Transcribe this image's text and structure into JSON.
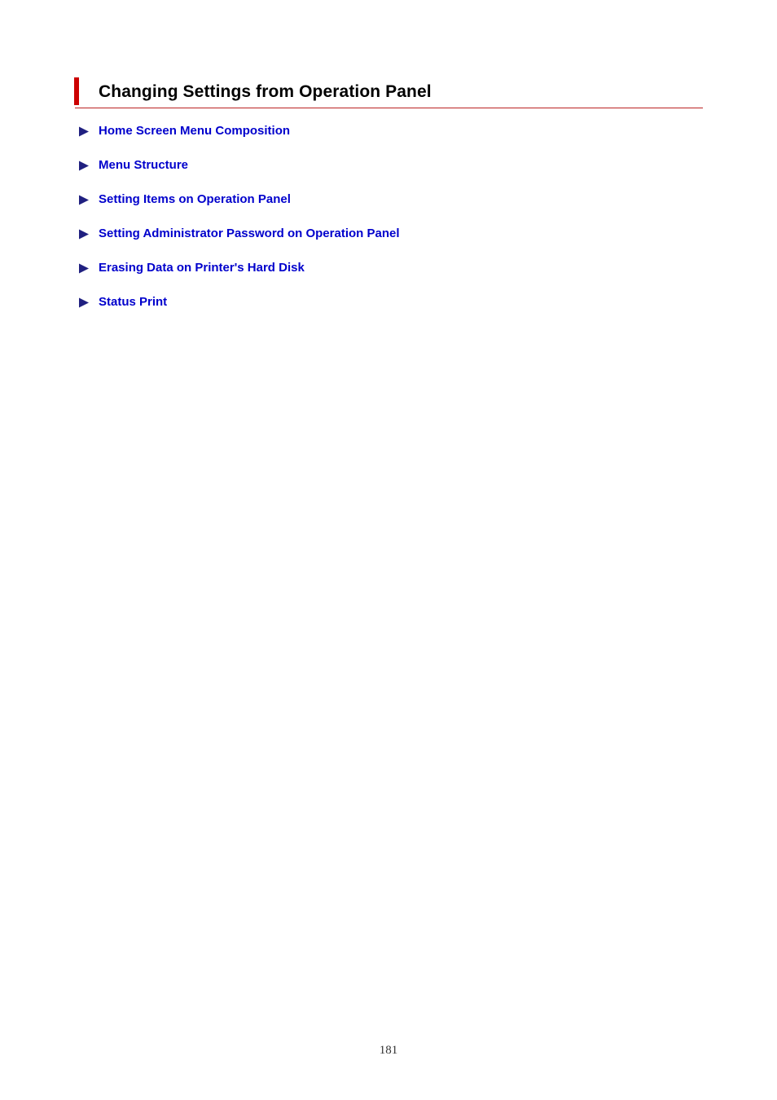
{
  "document": {
    "title": "Changing Settings from Operation Panel",
    "accent_color": "#CC0000",
    "rule_color": "#BB2222",
    "link_color": "#0000CC",
    "arrow_color": "#202080",
    "page_number": "181"
  },
  "links": [
    {
      "label": "Home Screen Menu Composition",
      "icon": "arrow-right-icon"
    },
    {
      "label": "Menu Structure",
      "icon": "arrow-right-icon"
    },
    {
      "label": "Setting Items on Operation Panel",
      "icon": "arrow-right-icon"
    },
    {
      "label": "Setting Administrator Password on Operation Panel",
      "icon": "arrow-right-icon"
    },
    {
      "label": "Erasing Data on Printer's Hard Disk",
      "icon": "arrow-right-icon"
    },
    {
      "label": "Status Print",
      "icon": "arrow-right-icon"
    }
  ]
}
